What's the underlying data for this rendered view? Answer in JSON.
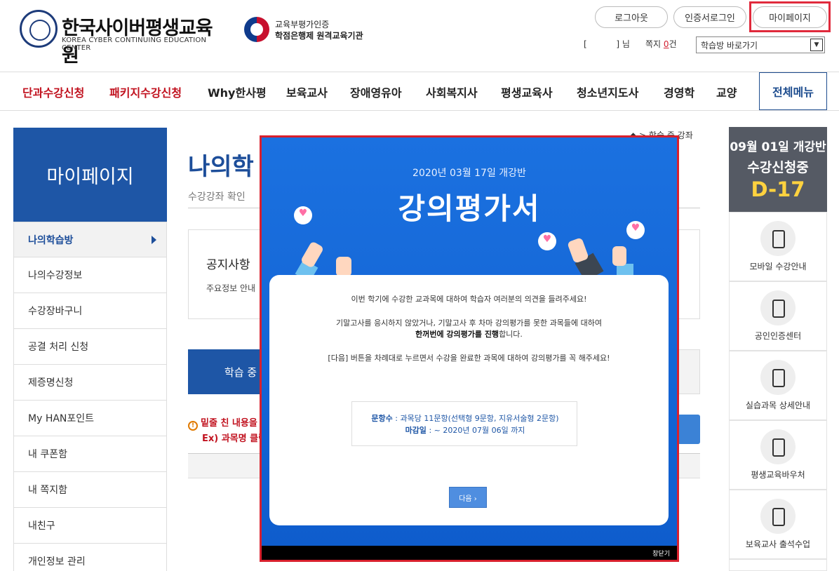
{
  "header": {
    "logo_main": "한국사이버평생교육원",
    "logo_sub": "KOREA CYBER CONTINUING EDUCATION CENTER",
    "cert_line1": "교육부평가인증",
    "cert_line2": "학점은행제 원격교육기관",
    "logout": "로그아웃",
    "cert_login": "인증서로그인",
    "mypage": "마이페이지",
    "user_open": "[",
    "user_close": "]",
    "user_suffix": "님",
    "memo_label": "쪽지",
    "memo_count": "0",
    "memo_unit": "건",
    "goto_select": "학습방 바로가기"
  },
  "nav": {
    "items": [
      "단과수강신청",
      "패키지수강신청",
      "Why한사평",
      "보육교사",
      "장애영유아",
      "사회복지사",
      "평생교육사",
      "청소년지도사",
      "경영학",
      "교양"
    ],
    "all_menu": "전체메뉴"
  },
  "sidebar": {
    "title": "마이페이지",
    "items": [
      "나의학습방",
      "나의수강정보",
      "수강장바구니",
      "공결 처리 신청",
      "제증명신청",
      "My HAN포인트",
      "내 쿠폰함",
      "내 쪽지함",
      "내친구",
      "개인정보 관리"
    ]
  },
  "main": {
    "crumb": "학습 중 강좌",
    "title": "나의학",
    "subtitle": "수강강좌 확인",
    "notice_title": "공지사항",
    "notice_text": "주요정보 안내",
    "tab_active": "학습 중",
    "warn1": "밑줄 친 내용을",
    "warn2": "Ex) 과목명 클릭"
  },
  "right": {
    "dday_line1": "09월 01일 개강반",
    "dday_line2": "수강신청중",
    "dday_count": "D-17",
    "items": [
      "모바일 수강안내",
      "공인인증센터",
      "실습과목 상세안내",
      "평생교육바우처",
      "보육교사 출석수업"
    ]
  },
  "modal": {
    "date": "2020년 03월 17일 개강반",
    "title": "강의평가서",
    "p1": "이번 학기에 수강한 교과목에 대하여 학습자 여러분의 의견을 들려주세요!",
    "p2": "기말고사를 응시하지 않았거나, 기말고사 후 차마 강의평가를 못한 과목들에 대하여",
    "p3_bold": "한꺼번에 강의평가를 진행",
    "p3_rest": "합니다.",
    "p4": "[다음] 버튼을 차례대로 누르면서 수강을 완료한 과목에 대하여 강의평가를 꼭 해주세요!",
    "info1_label": "문항수",
    "info1_value": ": 과목당 11문항(선택형 9문항, 지유서술형 2문항)",
    "info2_label": "마감일",
    "info2_value": ": ~ 2020년 07월 06일 까지",
    "next": "다음 ›",
    "close": "창닫기"
  },
  "colors": {
    "brand_blue": "#1e56a6",
    "modal_blue": "#1467d6",
    "highlight_red": "#e02a3c",
    "dday_yellow": "#ffd23f"
  }
}
